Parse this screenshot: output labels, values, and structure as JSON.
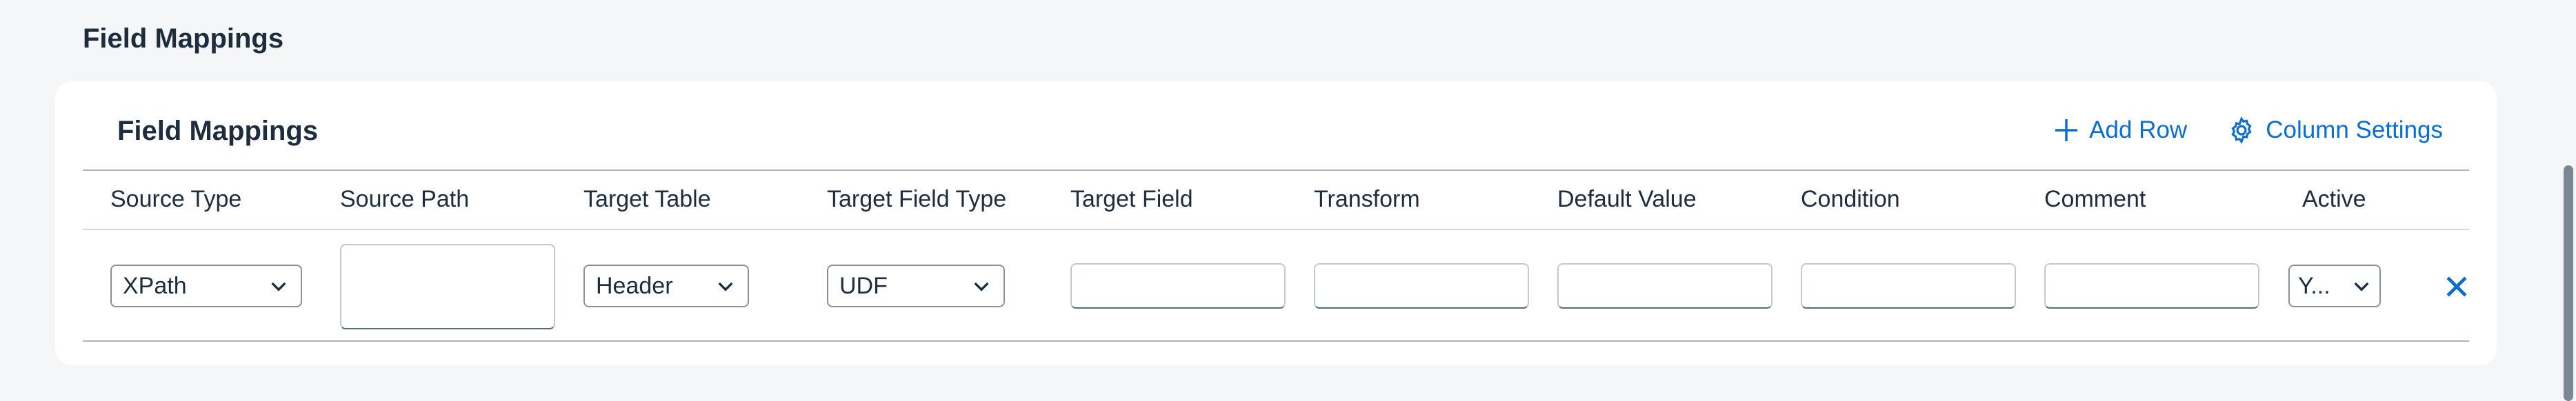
{
  "section": {
    "title": "Field Mappings"
  },
  "card": {
    "title": "Field Mappings",
    "toolbar": {
      "add_row_label": "Add Row",
      "column_settings_label": "Column Settings"
    }
  },
  "table": {
    "columns": [
      "Source Type",
      "Source Path",
      "Target Table",
      "Target Field Type",
      "Target Field",
      "Transform",
      "Default Value",
      "Condition",
      "Comment",
      "Active"
    ],
    "row": {
      "source_type": "XPath",
      "source_path": "",
      "target_table": "Header",
      "target_field_type": "UDF",
      "target_field": "",
      "transform": "",
      "default_value": "",
      "condition": "",
      "comment": "",
      "active": "Y..."
    }
  },
  "colors": {
    "accent": "#0a6ed1",
    "text": "#1d2d3e",
    "background": "#f5f6f7"
  }
}
